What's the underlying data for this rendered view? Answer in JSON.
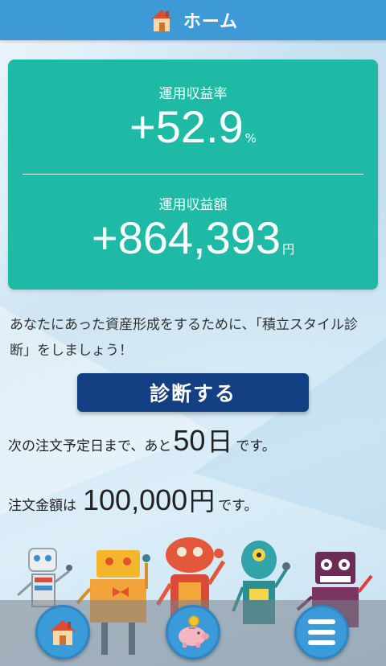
{
  "header": {
    "title": "ホーム",
    "icon": "house-icon"
  },
  "summary": {
    "rate_label": "運用収益率",
    "rate_value": "+52.9",
    "rate_unit": "%",
    "amount_label": "運用収益額",
    "amount_value": "+864,393",
    "amount_unit": "円"
  },
  "description": "あなたにあった資産形成をするために、「積立スタイル診断」をしましょう！",
  "diagnose_button": "診断する",
  "next_order": {
    "prefix": "次の注文予定日まで、あと",
    "days": "50",
    "days_unit": "日",
    "suffix": "です。"
  },
  "order_amount": {
    "prefix": "注文金額は",
    "value": "100,000",
    "unit": "円",
    "suffix": "です。"
  },
  "bottom_nav": {
    "items": [
      {
        "name": "home",
        "icon": "house-icon"
      },
      {
        "name": "savings",
        "icon": "piggy-bank-icon"
      },
      {
        "name": "menu",
        "icon": "hamburger-menu-icon"
      }
    ]
  },
  "colors": {
    "header": "#3d9ad6",
    "card": "#1fbaa6",
    "button": "#133f83",
    "nav_button": "#3b9ad8"
  }
}
